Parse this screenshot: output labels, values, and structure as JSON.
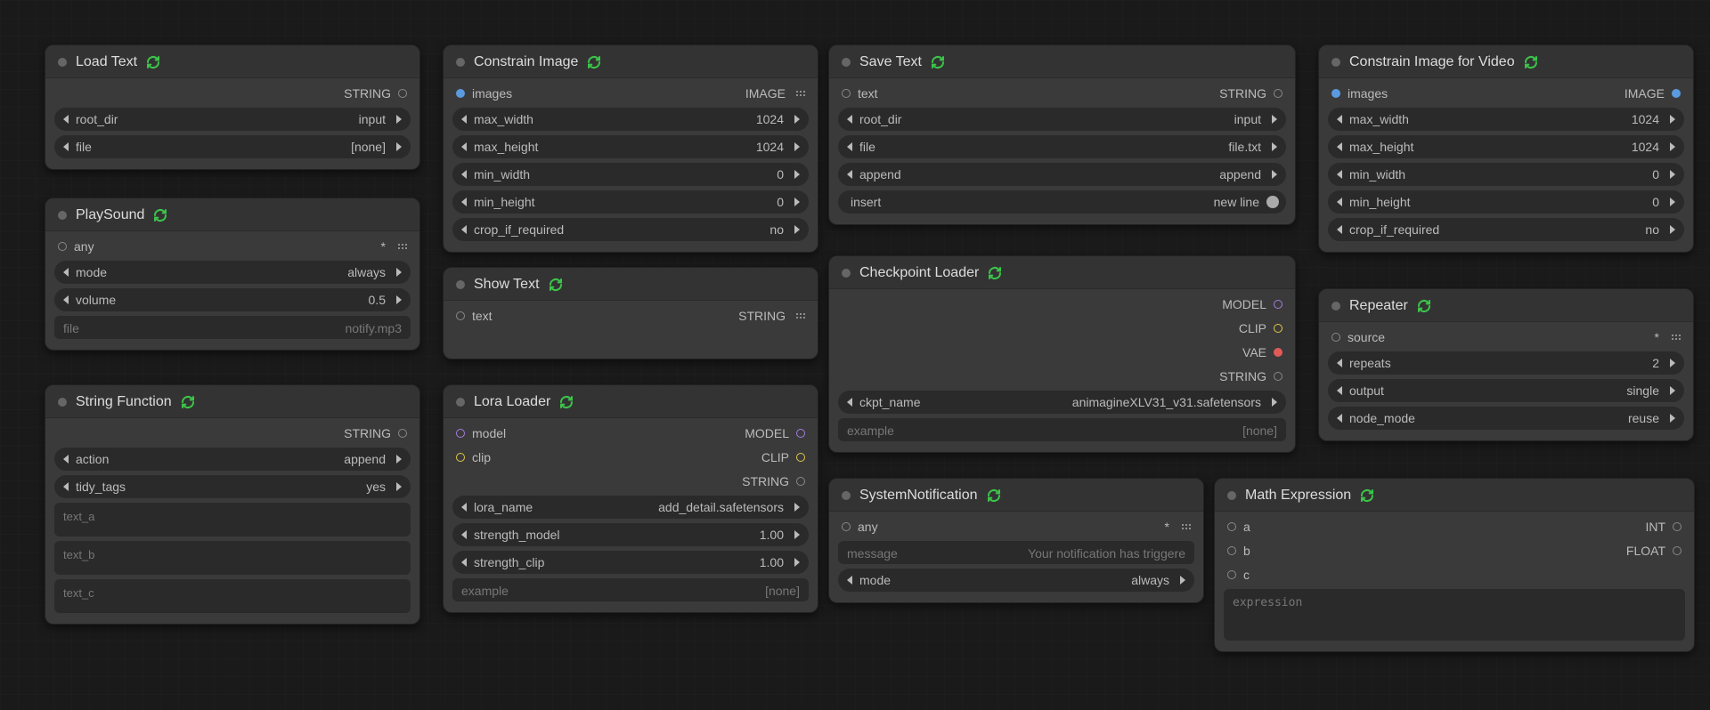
{
  "nodes": {
    "load_text": {
      "title": "Load Text",
      "outputs": [
        {
          "label": "STRING"
        }
      ],
      "widgets": [
        {
          "label": "root_dir",
          "value": "input"
        },
        {
          "label": "file",
          "value": "[none]"
        }
      ]
    },
    "playsound": {
      "title": "PlaySound",
      "inputs": [
        {
          "label": "any"
        }
      ],
      "widgets": [
        {
          "label": "mode",
          "value": "always"
        },
        {
          "label": "volume",
          "value": "0.5"
        }
      ],
      "textboxes": [
        {
          "left": "file",
          "right": "notify.mp3"
        }
      ]
    },
    "string_function": {
      "title": "String Function",
      "outputs": [
        {
          "label": "STRING"
        }
      ],
      "widgets": [
        {
          "label": "action",
          "value": "append"
        },
        {
          "label": "tidy_tags",
          "value": "yes"
        }
      ],
      "textareas": [
        "text_a",
        "text_b",
        "text_c"
      ]
    },
    "constrain_image": {
      "title": "Constrain Image",
      "inputs": [
        {
          "label": "images"
        }
      ],
      "outputs": [
        {
          "label": "IMAGE"
        }
      ],
      "widgets": [
        {
          "label": "max_width",
          "value": "1024"
        },
        {
          "label": "max_height",
          "value": "1024"
        },
        {
          "label": "min_width",
          "value": "0"
        },
        {
          "label": "min_height",
          "value": "0"
        },
        {
          "label": "crop_if_required",
          "value": "no"
        }
      ]
    },
    "show_text": {
      "title": "Show Text",
      "inputs": [
        {
          "label": "text"
        }
      ],
      "outputs": [
        {
          "label": "STRING"
        }
      ]
    },
    "lora_loader": {
      "title": "Lora Loader",
      "inputs": [
        {
          "label": "model"
        },
        {
          "label": "clip"
        }
      ],
      "outputs": [
        {
          "label": "MODEL"
        },
        {
          "label": "CLIP"
        },
        {
          "label": "STRING"
        }
      ],
      "widgets": [
        {
          "label": "lora_name",
          "value": "add_detail.safetensors"
        },
        {
          "label": "strength_model",
          "value": "1.00"
        },
        {
          "label": "strength_clip",
          "value": "1.00"
        }
      ],
      "placeholder": {
        "left": "example",
        "right": "[none]"
      }
    },
    "save_text": {
      "title": "Save Text",
      "inputs": [
        {
          "label": "text"
        }
      ],
      "outputs": [
        {
          "label": "STRING"
        }
      ],
      "widgets": [
        {
          "label": "root_dir",
          "value": "input"
        },
        {
          "label": "file",
          "value": "file.txt"
        },
        {
          "label": "append",
          "value": "append"
        }
      ],
      "toggle": {
        "label": "insert",
        "value": "new line"
      }
    },
    "checkpoint_loader": {
      "title": "Checkpoint Loader",
      "outputs": [
        {
          "label": "MODEL"
        },
        {
          "label": "CLIP"
        },
        {
          "label": "VAE"
        },
        {
          "label": "STRING"
        }
      ],
      "widgets": [
        {
          "label": "ckpt_name",
          "value": "animagineXLV31_v31.safetensors"
        }
      ],
      "placeholder": {
        "left": "example",
        "right": "[none]"
      }
    },
    "system_notification": {
      "title": "SystemNotification",
      "inputs": [
        {
          "label": "any"
        }
      ],
      "textboxes": [
        {
          "left": "message",
          "right": "Your notification has triggere"
        }
      ],
      "widgets": [
        {
          "label": "mode",
          "value": "always"
        }
      ]
    },
    "constrain_image_video": {
      "title": "Constrain Image for Video",
      "inputs": [
        {
          "label": "images"
        }
      ],
      "outputs": [
        {
          "label": "IMAGE"
        }
      ],
      "widgets": [
        {
          "label": "max_width",
          "value": "1024"
        },
        {
          "label": "max_height",
          "value": "1024"
        },
        {
          "label": "min_width",
          "value": "0"
        },
        {
          "label": "min_height",
          "value": "0"
        },
        {
          "label": "crop_if_required",
          "value": "no"
        }
      ]
    },
    "repeater": {
      "title": "Repeater",
      "inputs": [
        {
          "label": "source"
        }
      ],
      "widgets": [
        {
          "label": "repeats",
          "value": "2"
        },
        {
          "label": "output",
          "value": "single"
        },
        {
          "label": "node_mode",
          "value": "reuse"
        }
      ]
    },
    "math_expression": {
      "title": "Math Expression",
      "inputs": [
        {
          "label": "a"
        },
        {
          "label": "b"
        },
        {
          "label": "c"
        }
      ],
      "outputs": [
        {
          "label": "INT"
        },
        {
          "label": "FLOAT"
        }
      ],
      "textarea": "expression"
    }
  }
}
